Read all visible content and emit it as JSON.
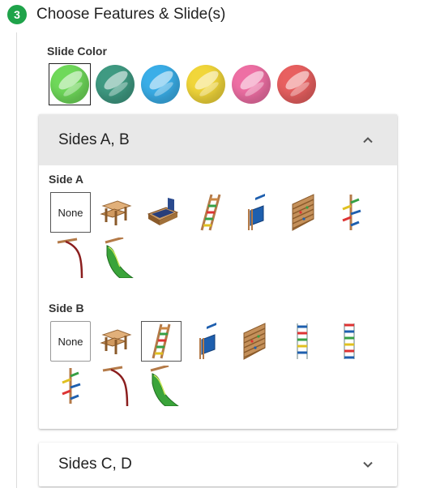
{
  "step": {
    "number": "3",
    "title": "Choose Features & Slide(s)"
  },
  "slide_color": {
    "label": "Slide Color",
    "swatches": [
      {
        "name": "green",
        "color": "#6fd95a",
        "selected": true
      },
      {
        "name": "teal",
        "color": "#3f9a82",
        "selected": false
      },
      {
        "name": "blue",
        "color": "#3aaee8",
        "selected": false
      },
      {
        "name": "yellow",
        "color": "#f1d63a",
        "selected": false
      },
      {
        "name": "pink",
        "color": "#ee6fa4",
        "selected": false
      },
      {
        "name": "red",
        "color": "#e86060",
        "selected": false
      }
    ]
  },
  "panels": {
    "ab": {
      "title": "Sides A, B",
      "expanded": true,
      "chevron": "chevron-up-icon"
    },
    "cd": {
      "title": "Sides C, D",
      "expanded": false,
      "chevron": "chevron-down-icon"
    }
  },
  "side_a": {
    "label": "Side A",
    "none_label": "None",
    "selected": "None",
    "options": [
      "picnic-table",
      "sandbox",
      "ladder",
      "rock-wall-panel",
      "climbing-wall",
      "climbing-pole",
      "fire-pole",
      "wave-slide"
    ]
  },
  "side_b": {
    "label": "Side B",
    "none_label": "None",
    "selected": "ladder",
    "options": [
      "picnic-table",
      "ladder",
      "rock-wall-panel",
      "climbing-wall",
      "rope-ladder",
      "rope-ladder-tall",
      "climbing-pole",
      "fire-pole",
      "wave-slide"
    ]
  }
}
